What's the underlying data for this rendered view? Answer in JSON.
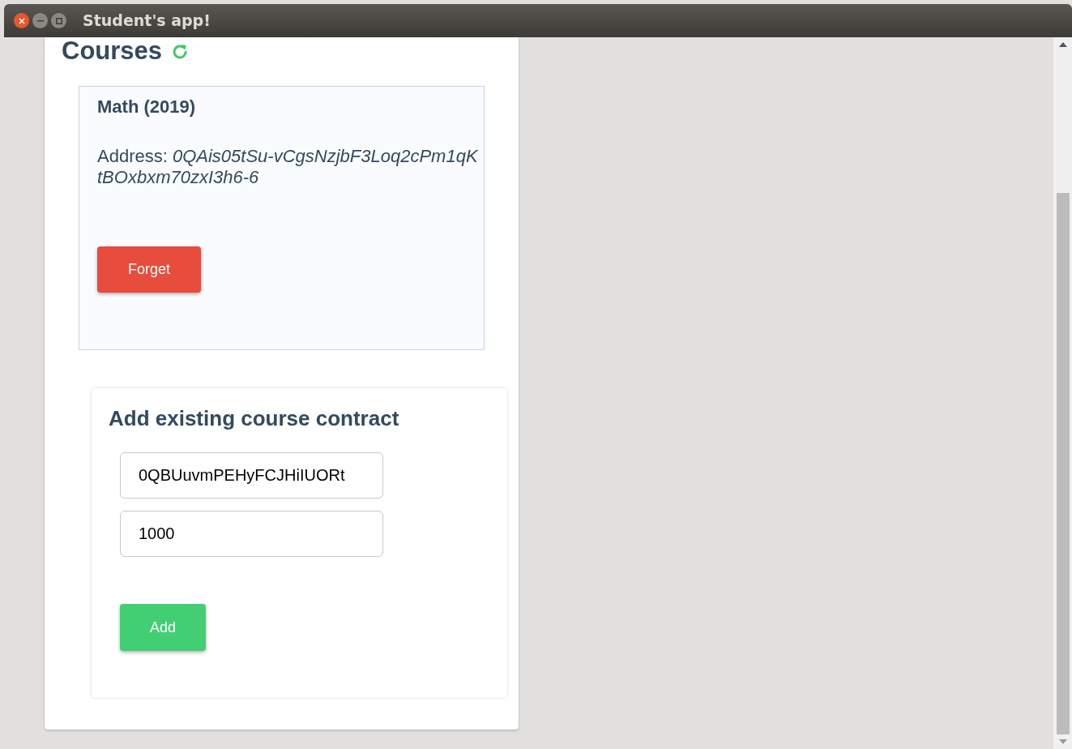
{
  "window": {
    "title": "Student's app!"
  },
  "courses": {
    "title": "Courses",
    "items": [
      {
        "name": "Math (2019)",
        "address_label": "Address:",
        "address": "0QAis05tSu-vCgsNzjbF3Loq2cPm1qKtBOxbxm70zxI3h6-6",
        "button": "Forget"
      }
    ]
  },
  "add_form": {
    "title": "Add existing course contract",
    "address_value": "0QBUuvmPEHyFCJHiIUORt",
    "amount_value": "1000",
    "button": "Add"
  }
}
